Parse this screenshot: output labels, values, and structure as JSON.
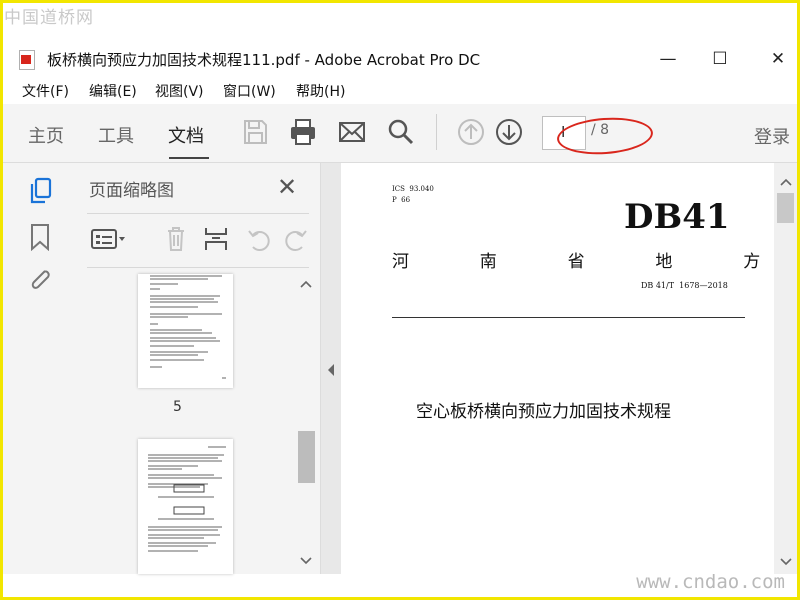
{
  "watermarks": {
    "top": "中国道桥网",
    "bottom": "www.cndao.com"
  },
  "window": {
    "title": "板桥横向预应力加固技术规程111.pdf - Adobe Acrobat Pro DC",
    "min_icon": "—",
    "max_icon": "☐",
    "close_icon": "✕"
  },
  "menu": [
    "文件(F)",
    "编辑(E)",
    "视图(V)",
    "窗口(W)",
    "帮助(H)"
  ],
  "toolbar": {
    "tabs": [
      "主页",
      "工具",
      "文档"
    ],
    "active_tab": "文档",
    "icons": [
      "save-icon",
      "print-icon",
      "email-icon",
      "search-icon",
      "page-up-icon",
      "page-down-icon"
    ],
    "page_current": "I",
    "page_total": "/ 8",
    "login": "登录",
    "annotation_color": "#d9261c"
  },
  "left_strip": {
    "icons": [
      "page-thumbnails-icon",
      "bookmark-icon",
      "attachment-icon"
    ],
    "accent": "#1a73d8"
  },
  "thumbnail_panel": {
    "title": "页面缩略图",
    "close": "✕",
    "thumbnails": [
      {
        "page_number": "5"
      },
      {
        "page_number": ""
      }
    ]
  },
  "document": {
    "classification": [
      "ICS  93.040",
      "P  66"
    ],
    "code": "DB41",
    "header": "河  南  省  地  方  标  准",
    "number": "DB 41/T  1678—2018",
    "title": "空心板桥横向预应力加固技术规程"
  }
}
